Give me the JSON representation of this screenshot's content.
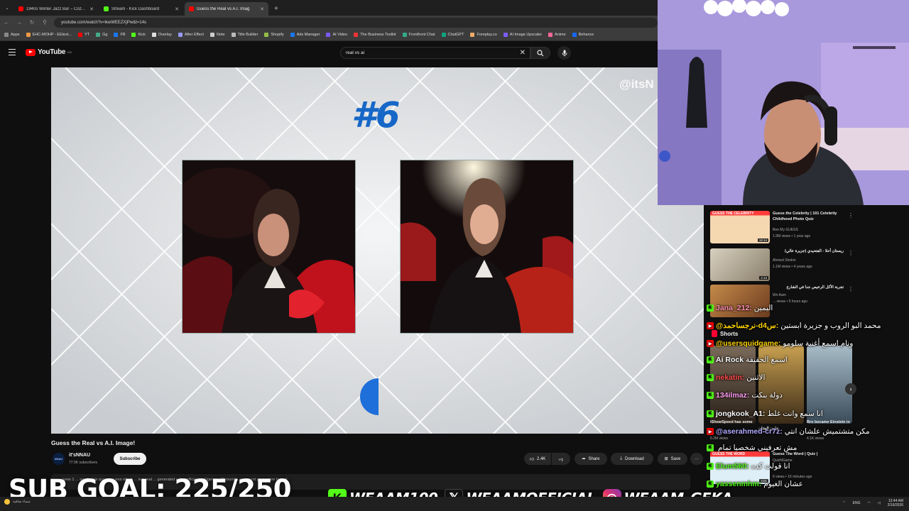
{
  "browser": {
    "tabs": [
      {
        "title": "1940s Winter Jazz Bar – Cozy V",
        "color": "#ff0000",
        "active": false
      },
      {
        "title": "Stream - Kick Dashboard",
        "color": "#53fc18",
        "active": false
      },
      {
        "title": "Guess the Real vs A.I. Imag",
        "color": "#ff0000",
        "active": true
      }
    ],
    "new_tab": "+",
    "url": "youtube.com/watch?v=lkwWEEZXjPw&t=14s",
    "bookmarks": [
      "Apps",
      "EHC-MOHP - EEtest...",
      "YT",
      "Gg",
      "FB",
      "Kick",
      "Overlay",
      "After Effect",
      "Note",
      "Title Builder",
      "Shopify",
      "Ads Manager",
      "AI Video",
      "The Business Toolkit",
      "Frontfront Chat",
      "ChatGPT",
      "Foreplay.co",
      "AI Image Upscaler",
      "Anime",
      "Behance"
    ]
  },
  "youtube": {
    "logo_text": "YouTube",
    "logo_sup": "EG",
    "search_value": "real vs ai"
  },
  "video": {
    "number": "#6",
    "watermark": "@itsN"
  },
  "details": {
    "title": "Guess the Real vs A.I. Image!",
    "channel": "it'sNNAU",
    "channel_avatar": "NNAU",
    "subscribers": "77.5K subscribers",
    "subscribe": "Subscribe",
    "likes": "2.4K",
    "share": "Share",
    "download": "Download",
    "save": "Save",
    "more": "···",
    "description": "... views  1 ... ago  In this quiz ... guess which ... is a real ... generated with artificial intelligence. 30 rounds, comment your score below!"
  },
  "sidebar": {
    "recommendations": [
      {
        "title": "Guess the Celebrity | 101 Celebrity Childhood Photo Quiz",
        "channel": "Bee My GUESS",
        "meta": "1.9M views • 1 year ago",
        "duration": "18:14",
        "thumb_label": "GUESS THE CELEBRITY"
      },
      {
        "title": "ريستان أحلا - الفتحيدي (جزيرة عالي)",
        "channel": "Ahmed Shokin",
        "meta": "1.1M views • 4 years ago",
        "duration": "4:13",
        "thumb_label": ""
      },
      {
        "title": "تجربة الأكل الرخيص جدا في الشارع",
        "channel": "Wo Aam",
        "meta": "... views • 5 hours ago",
        "duration": "",
        "thumb_label": ""
      }
    ],
    "shorts_label": "Shorts",
    "shorts": [
      {
        "caption": "iShowSpeed has some",
        "views": "6.2M views"
      },
      {
        "caption": "جلون الهنتان",
        "views": ""
      },
      {
        "caption": "Bro became Einstein in",
        "views": "4.1K views"
      }
    ],
    "rec_bottom": {
      "title": "Guess The Word | Quiz |",
      "channel": "QuizNGame",
      "meta": "6 views • 16 minutes ago",
      "duration": "3:01",
      "thumb_label": "GUESS THE WORD"
    }
  },
  "stream_overlay": {
    "sub_goal": "SUB GOAL: 225/250",
    "socials": [
      {
        "icon": "kick",
        "handle": "WEAAM100",
        "color": "#53fc18"
      },
      {
        "icon": "x",
        "handle": "WEAAMOFFICIAL",
        "color": "#111111"
      },
      {
        "icon": "instagram",
        "handle": "WEAAM_GEKA",
        "color": "#e1306c"
      }
    ]
  },
  "chat": [
    {
      "platform": "kick",
      "user": "Jana_212:",
      "text": "اليمين",
      "color": "#ff8fb1"
    },
    {
      "platform": "youtube",
      "user": "@نرجساحمد-d4س:",
      "text": "محمد البو الروب و جزيرة ابستين",
      "color": "#ffd400"
    },
    {
      "platform": "youtube",
      "user": "@usersquidgame:",
      "text": "ونام اسمع أغنية سلومو",
      "color": "#ffd400"
    },
    {
      "platform": "kick",
      "user": "Ai Rock",
      "text": "اسمع الحقيقة",
      "color": "#ffffff"
    },
    {
      "platform": "kick",
      "user": "nekatin:",
      "text": "الاثنين",
      "color": "#ff4a4a"
    },
    {
      "platform": "kick",
      "user": "134ilmaz:",
      "text": "دولة بنكت",
      "color": "#ff9cf0"
    },
    {
      "platform": "kick",
      "user": "jongkook_A1:",
      "text": "انا سمع وانت غلط",
      "color": "#ffffff"
    },
    {
      "platform": "youtube",
      "user": "@aserahmed-cr7z:",
      "text": "مكن متشتميش علشان انتي",
      "color": "#b0a8ff"
    },
    {
      "platform": "kick",
      "user": "",
      "text": "مش تعرفيني شخصيا تمام",
      "color": "#ffffff"
    },
    {
      "platform": "kick",
      "user": "Elum560:",
      "text": "انا قولت كده",
      "color": "#53fc18"
    },
    {
      "platform": "kick",
      "user": "yassenmhm:",
      "text": "عشان الغيوم",
      "color": "#53fc18"
    }
  ],
  "taskbar": {
    "weather": "سماء صافية",
    "lang": "ENG",
    "time": "12:44 AM",
    "date": "2/16/2026"
  }
}
